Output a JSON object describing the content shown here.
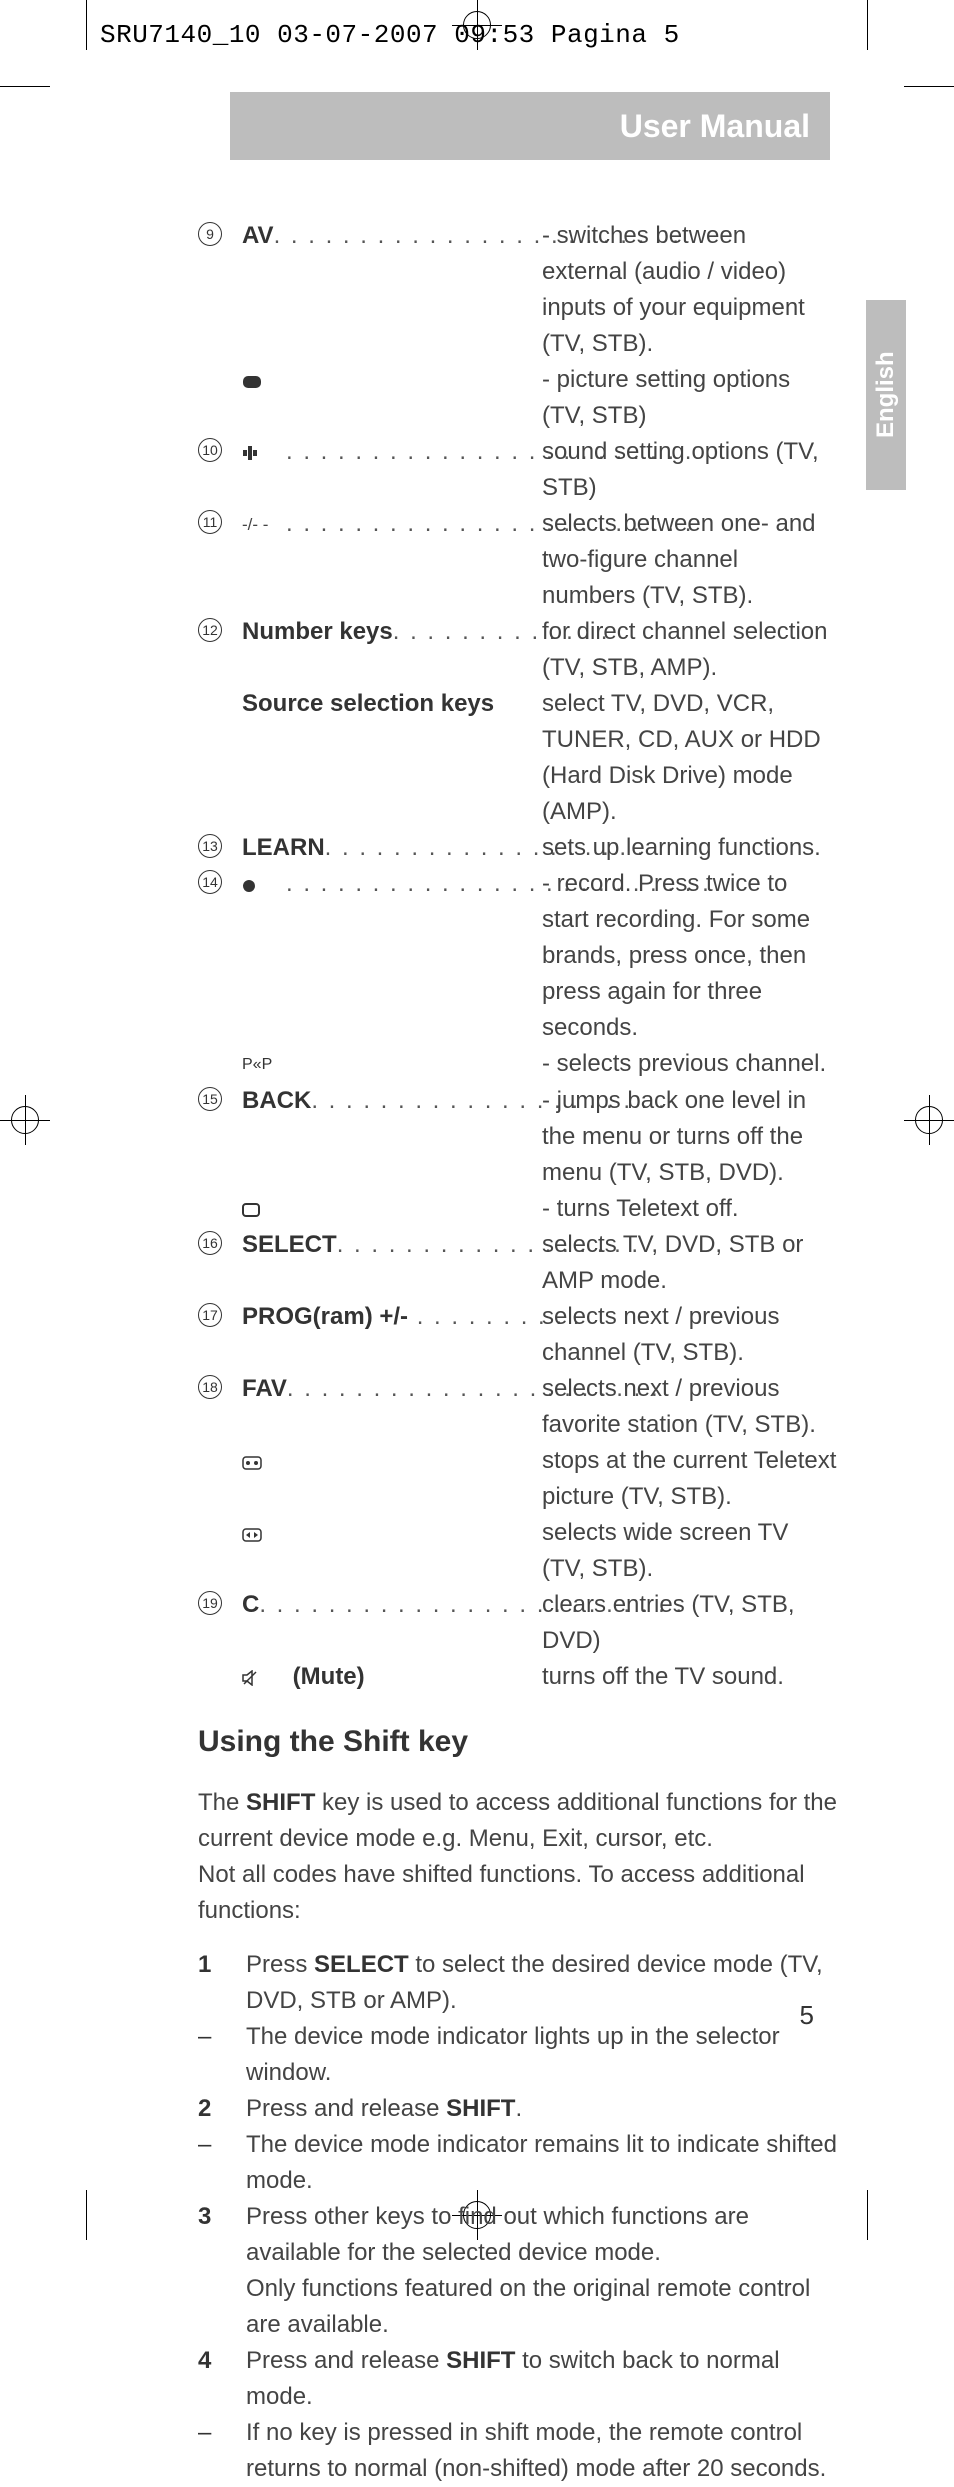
{
  "slug": "SRU7140_10  03-07-2007  09:53  Pagina 5",
  "title": "User Manual",
  "language_tab": "English",
  "page_number": "5",
  "items": {
    "i9": {
      "num": "9",
      "term": "AV",
      "dots": ". . . . . . . . . . . . . . . . . . . . . . . .",
      "desc": "- switches between external (audio / video) inputs of your equipment (TV, STB).",
      "sub_icon_name": "picture-settings-icon",
      "sub_desc": "- picture setting options (TV, STB)"
    },
    "i10": {
      "num": "10",
      "icon_name": "sound-settings-icon",
      "dots": ". . . . . . . . . . . . . . . . . . . . . . . .",
      "desc": "sound setting options (TV, STB)"
    },
    "i11": {
      "num": "11",
      "icon_name": "digit-entry-icon",
      "dots": ". . . . . . . . . . . . . . . . . . . . . . . .",
      "desc": "selects between one- and two-figure channel numbers (TV, STB)."
    },
    "i12": {
      "num": "12",
      "term": "Number keys",
      "dots": ". . . . . . . . . . . . .",
      "desc": "for direct channel selection (TV, STB, AMP).",
      "term2": "Source selection keys",
      "desc2": "select TV, DVD, VCR, TUNER, CD, AUX or HDD (Hard Disk Drive) mode (AMP)."
    },
    "i13": {
      "num": "13",
      "term": "LEARN",
      "dots": ". . . . . . . . . . . . . . . . . . .",
      "desc": "sets up learning functions."
    },
    "i14": {
      "num": "14",
      "icon_name": "record-icon",
      "dots": ". . . . . . . . . . . . . . . . . . . . . . . . .",
      "desc": "- record. Press twice to start recording. For some brands, press once, then press again for three seconds.",
      "sub_icon_name": "previous-channel-icon",
      "sub_icon_text": "P«P",
      "sub_desc": "- selects previous channel."
    },
    "i15": {
      "num": "15",
      "term": "BACK",
      "dots": ". . . . . . . . . . . . . . . . . . . . .",
      "desc": "- jumps back one level in the menu or turns off the menu (TV, STB, DVD).",
      "sub_icon_name": "teletext-off-icon",
      "sub_desc": "- turns Teletext off."
    },
    "i16": {
      "num": "16",
      "term": "SELECT",
      "dots": ". . . . . . . . . . . . . . . . . .",
      "desc": "selects TV, DVD, STB or AMP mode."
    },
    "i17": {
      "num": "17",
      "term": "PROG(ram) +/-",
      "dots": " . . . . . . . . . .",
      "desc": "selects next / previous channel (TV, STB)."
    },
    "i18": {
      "num": "18",
      "term": "FAV",
      "dots": ". . . . . . . . . . . . . . . . . . . . . .",
      "desc": "selects next / previous favorite station (TV, STB).",
      "sub1_icon_name": "teletext-hold-icon",
      "sub1_desc": "stops at the current Teletext picture (TV, STB).",
      "sub2_icon_name": "widescreen-icon",
      "sub2_desc": "selects wide screen TV (TV, STB)."
    },
    "i19": {
      "num": "19",
      "term": "C",
      "dots": ". . . . . . . . . . . . . . . . . . . . . . . . .",
      "desc": "clears entries (TV, STB, DVD)",
      "sub_icon_name": "mute-icon",
      "sub_label": "(Mute)",
      "sub_desc": "turns off the TV sound."
    }
  },
  "shift": {
    "heading": "Using the Shift key",
    "intro_pre": "The ",
    "intro_bold": "SHIFT",
    "intro_post": " key is used to access additional functions for the current device mode e.g. Menu, Exit, cursor, etc.",
    "intro2": "Not all codes have shifted functions. To access additional functions:",
    "steps": {
      "s1": {
        "n": "1",
        "pre": "Press ",
        "bold": "SELECT",
        "post": " to select the desired device mode (TV, DVD, STB or AMP)."
      },
      "n1": {
        "m": "–",
        "text": "The device mode indicator lights up in the selector window."
      },
      "s2": {
        "n": "2",
        "pre": "Press and release ",
        "bold": "SHIFT",
        "post": "."
      },
      "n2": {
        "m": "–",
        "text": "The device mode indicator remains lit to indicate shifted mode."
      },
      "s3": {
        "n": "3",
        "text": "Press other keys to find out which functions are available for the selected device mode.",
        "text2": "Only functions featured on the original remote control are available."
      },
      "s4": {
        "n": "4",
        "pre": "Press and release ",
        "bold": "SHIFT",
        "post": " to switch back to normal mode."
      },
      "n3": {
        "m": "–",
        "text": "If no key is pressed in shift mode, the remote control returns to normal (non-shifted) mode after 20 seconds."
      }
    }
  }
}
